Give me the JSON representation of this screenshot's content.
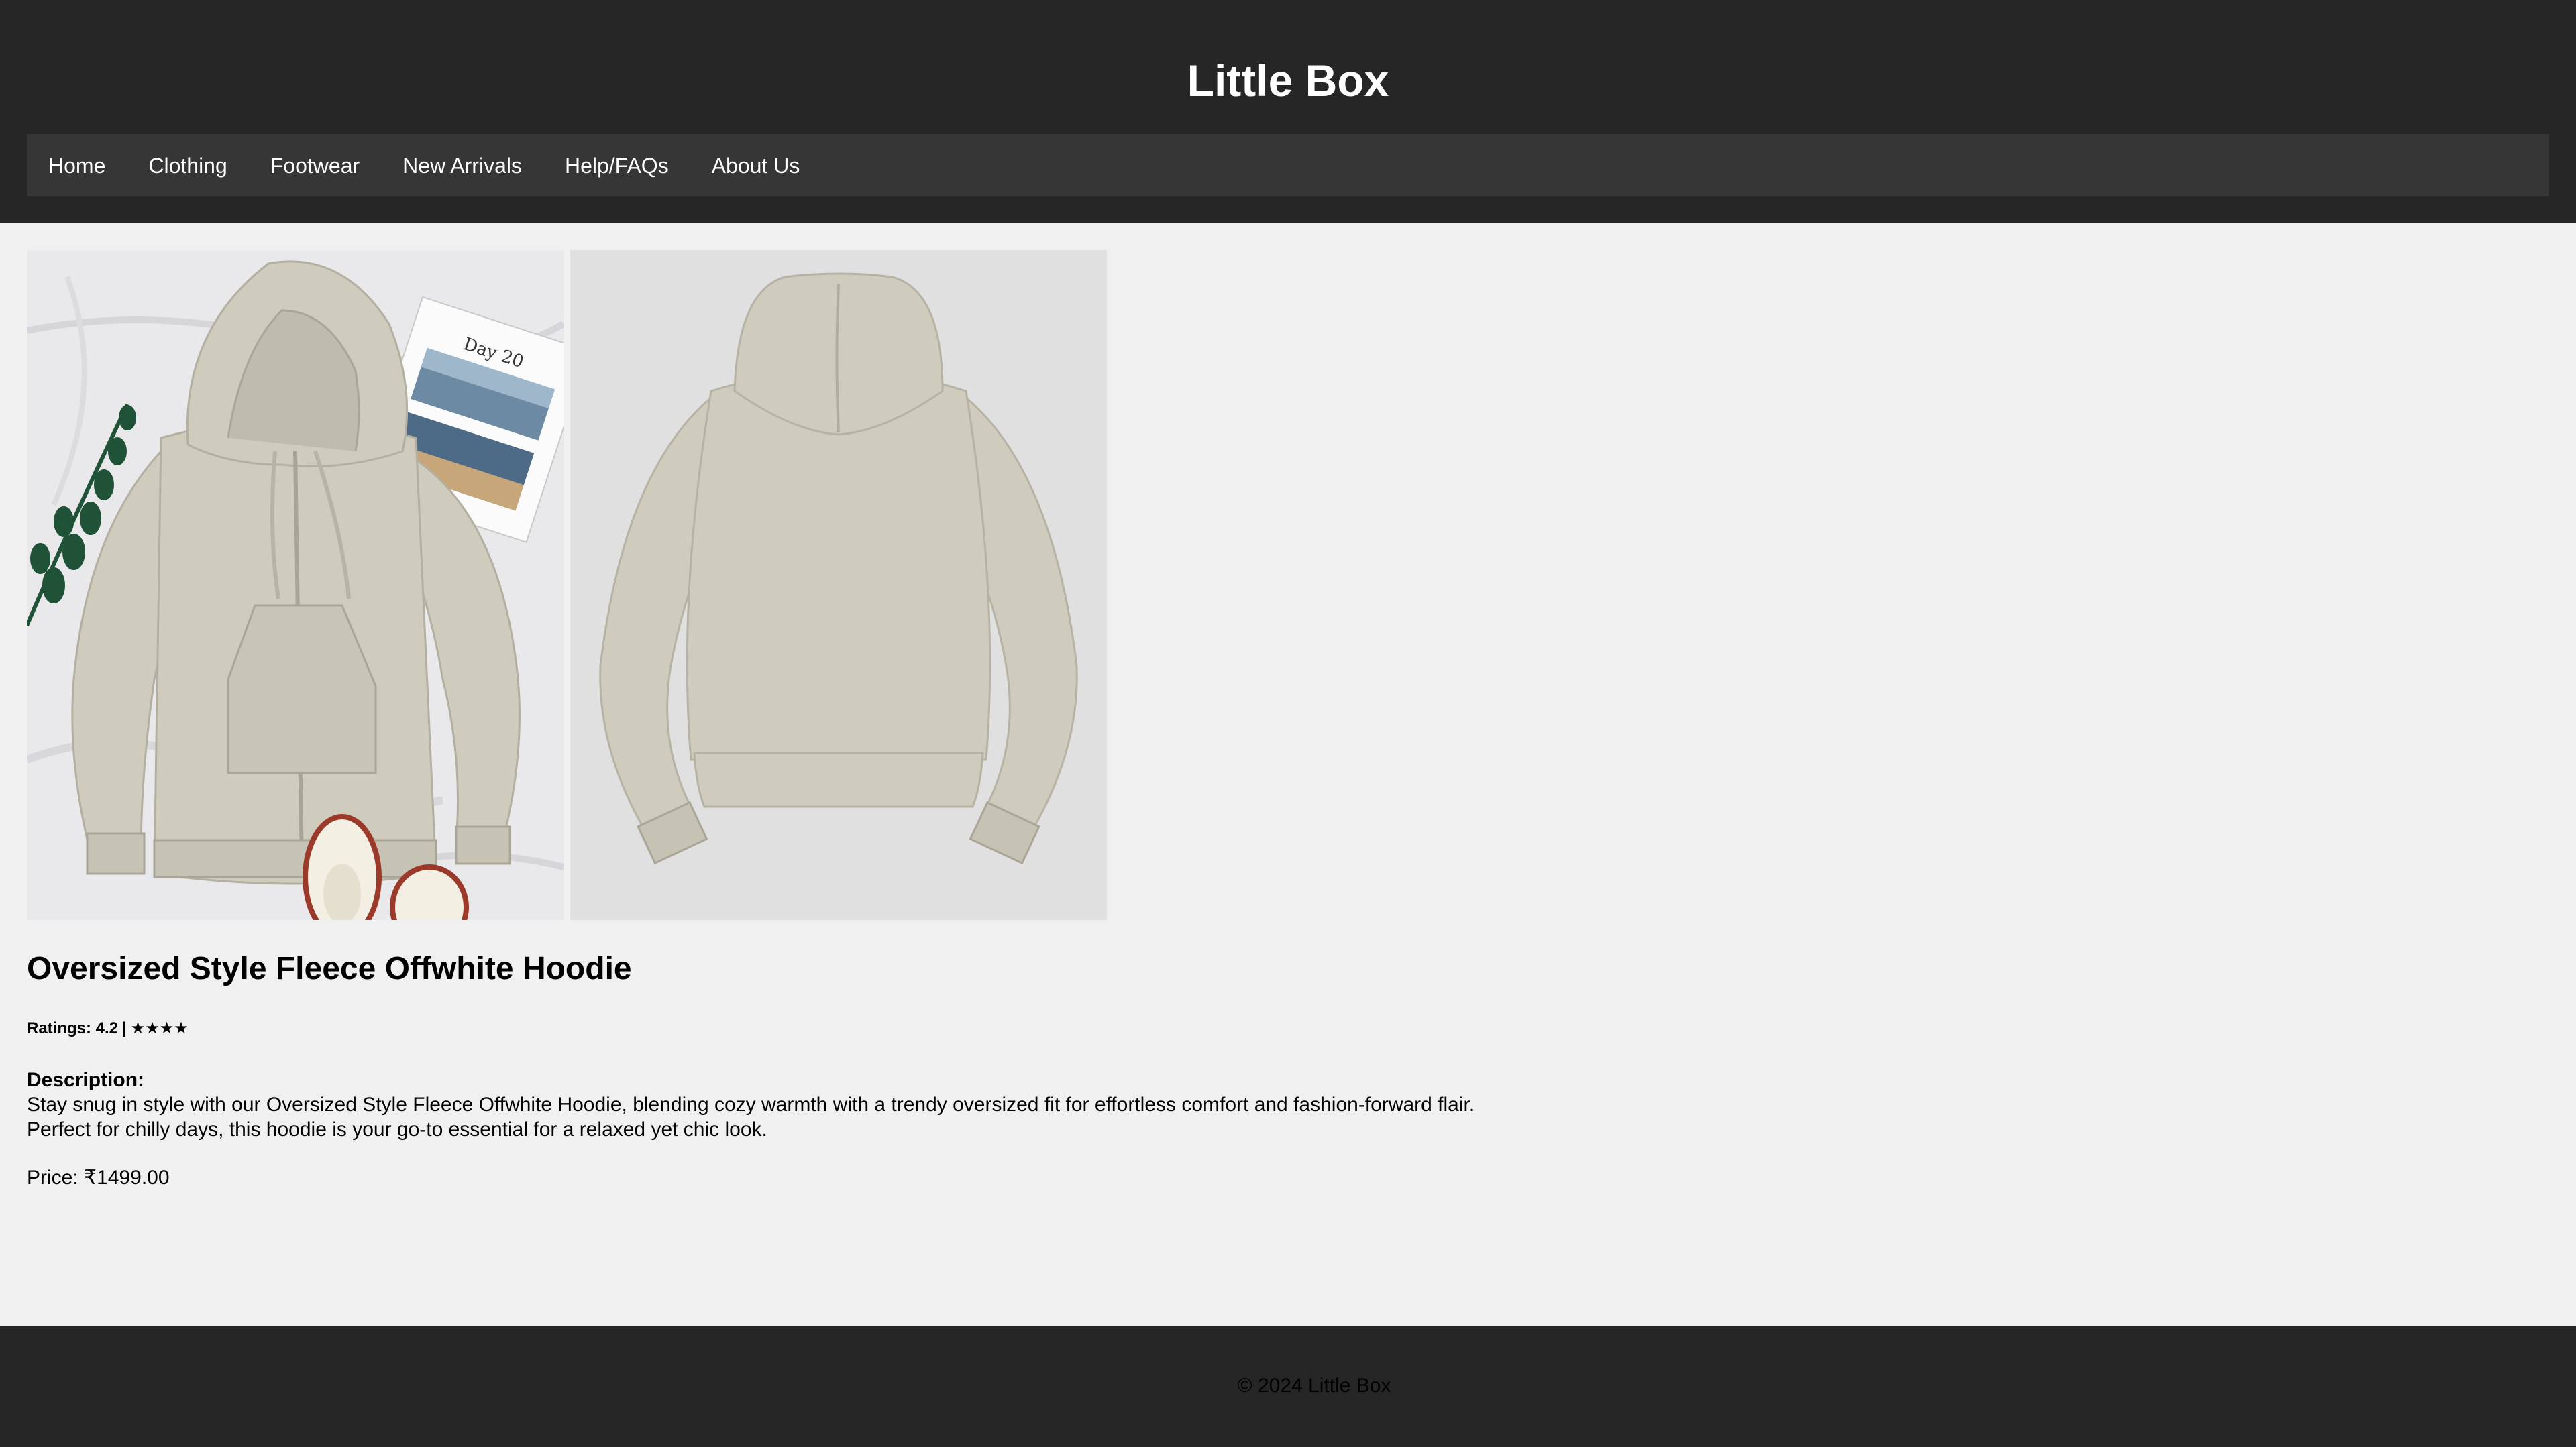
{
  "header": {
    "title": "Little Box",
    "nav": [
      {
        "label": "Home"
      },
      {
        "label": "Clothing"
      },
      {
        "label": "Footwear"
      },
      {
        "label": "New Arrivals"
      },
      {
        "label": "Help/FAQs"
      },
      {
        "label": "About Us"
      }
    ]
  },
  "product": {
    "images": [
      {
        "icon": "hoodie-front-photo"
      },
      {
        "icon": "hoodie-back-photo"
      }
    ],
    "name": "Oversized Style Fleece Offwhite Hoodie",
    "ratings_label": "Ratings: 4.2",
    "ratings_separator": "|",
    "ratings_stars": "★★★★",
    "rating_value": 4.2,
    "description_heading": "Description:",
    "description_line1": "Stay snug in style with our Oversized Style Fleece Offwhite Hoodie, blending cozy warmth with a trendy oversized fit for effortless comfort and fashion-forward flair.",
    "description_line2": "Perfect for chilly days, this hoodie is your go-to essential for a relaxed yet chic look.",
    "price": "Price: ₹1499.00"
  },
  "footer": {
    "copyright": "© 2024 Little Box"
  },
  "colors": {
    "header_bg": "#262626",
    "nav_bg": "#363636",
    "page_bg": "#f0f0f0",
    "hoodie": "#cfcbbd"
  }
}
